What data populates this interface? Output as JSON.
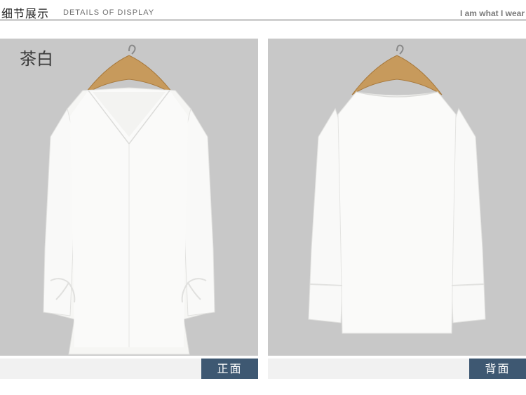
{
  "header": {
    "title": "细节展示",
    "subtitle": "DETAILS OF DISPLAY",
    "slogan": "I am what I wear"
  },
  "panels": {
    "front": {
      "color_label": "茶白",
      "caption": "正面"
    },
    "back": {
      "caption": "背面"
    }
  },
  "colors": {
    "panel_bg": "#c8c8c8",
    "caption_bg": "#3e5872",
    "caption_bar_bg": "#f1f1f1",
    "garment": "#f6f6f4",
    "hanger": "#c79a5c"
  }
}
